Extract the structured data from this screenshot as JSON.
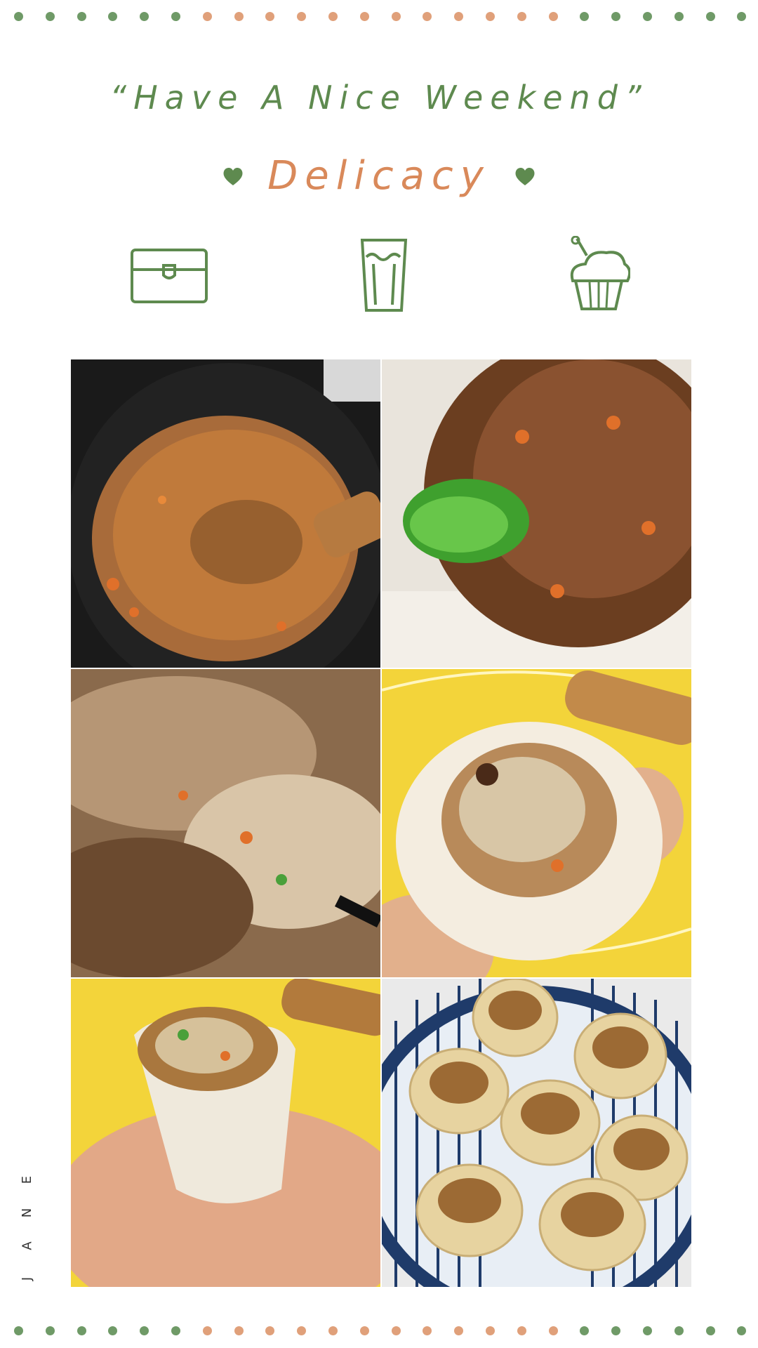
{
  "header": {
    "title": "“Have A Nice Weekend”",
    "subtitle": "Delicacy"
  },
  "colors": {
    "green": "#5e8a4f",
    "orange": "#d9895a",
    "dot_green": "#6f9a67",
    "dot_orange": "#e0a07a"
  },
  "icons": [
    "briefcase-icon",
    "drink-cup-icon",
    "cupcake-icon",
    "heart-icon"
  ],
  "photos": [
    {
      "name": "stir-fry-filling-in-wok-photo"
    },
    {
      "name": "filling-with-scallions-and-rice-photo"
    },
    {
      "name": "mixed-sticky-rice-filling-photo"
    },
    {
      "name": "filling-on-dumpling-wrapper-photo"
    },
    {
      "name": "shaomai-in-hand-photo"
    },
    {
      "name": "shaomai-plate-photo"
    }
  ],
  "signature": {
    "letters": [
      "J",
      "A",
      "N",
      "E"
    ]
  }
}
